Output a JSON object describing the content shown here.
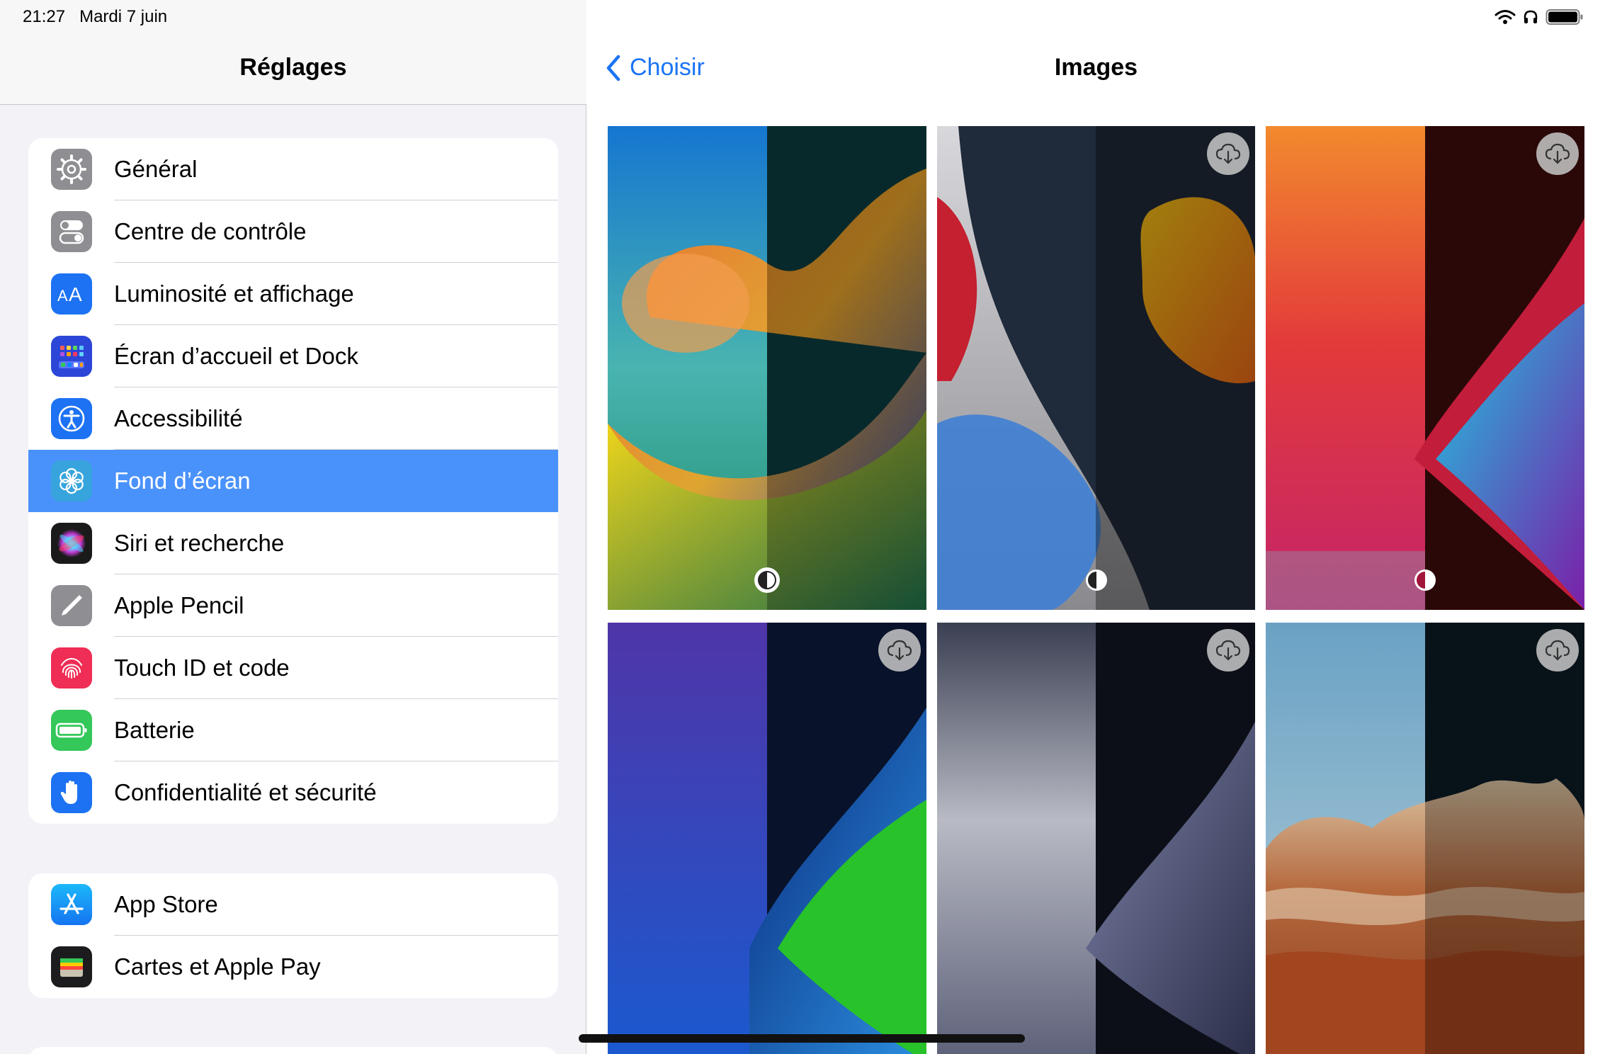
{
  "status": {
    "time": "21:27",
    "date": "Mardi 7 juin"
  },
  "sidebar": {
    "title": "Réglages",
    "group1": [
      {
        "label": "Général",
        "icon": "gear-icon",
        "color": "#8e8e93"
      },
      {
        "label": "Centre de contrôle",
        "icon": "toggles-icon",
        "color": "#8e8e93"
      },
      {
        "label": "Luminosité et affichage",
        "icon": "text-size-icon",
        "color": "#1c72f2"
      },
      {
        "label": "Écran d’accueil et Dock",
        "icon": "home-grid-icon",
        "color": "#2c46d8"
      },
      {
        "label": "Accessibilité",
        "icon": "accessibility-icon",
        "color": "#1c72f2"
      },
      {
        "label": "Fond d’écran",
        "icon": "flower-icon",
        "color": "#38a4dd",
        "selected": true
      },
      {
        "label": "Siri et recherche",
        "icon": "siri-icon",
        "color": "#1a1a1a"
      },
      {
        "label": "Apple Pencil",
        "icon": "pencil-icon",
        "color": "#8e8e93"
      },
      {
        "label": "Touch ID et code",
        "icon": "fingerprint-icon",
        "color": "#ef2d55"
      },
      {
        "label": "Batterie",
        "icon": "battery-icon",
        "color": "#34c759"
      },
      {
        "label": "Confidentialité et sécurité",
        "icon": "hand-icon",
        "color": "#1c72f2"
      }
    ],
    "group2": [
      {
        "label": "App Store",
        "icon": "app-store-icon",
        "color": "#1a8cf6"
      },
      {
        "label": "Cartes et Apple Pay",
        "icon": "wallet-icon",
        "color": "#1c1c1e"
      }
    ]
  },
  "detail": {
    "back_label": "Choisir",
    "title": "Images"
  },
  "colors": {
    "accent": "#1b74f5",
    "selected_row": "#4a92fb"
  }
}
